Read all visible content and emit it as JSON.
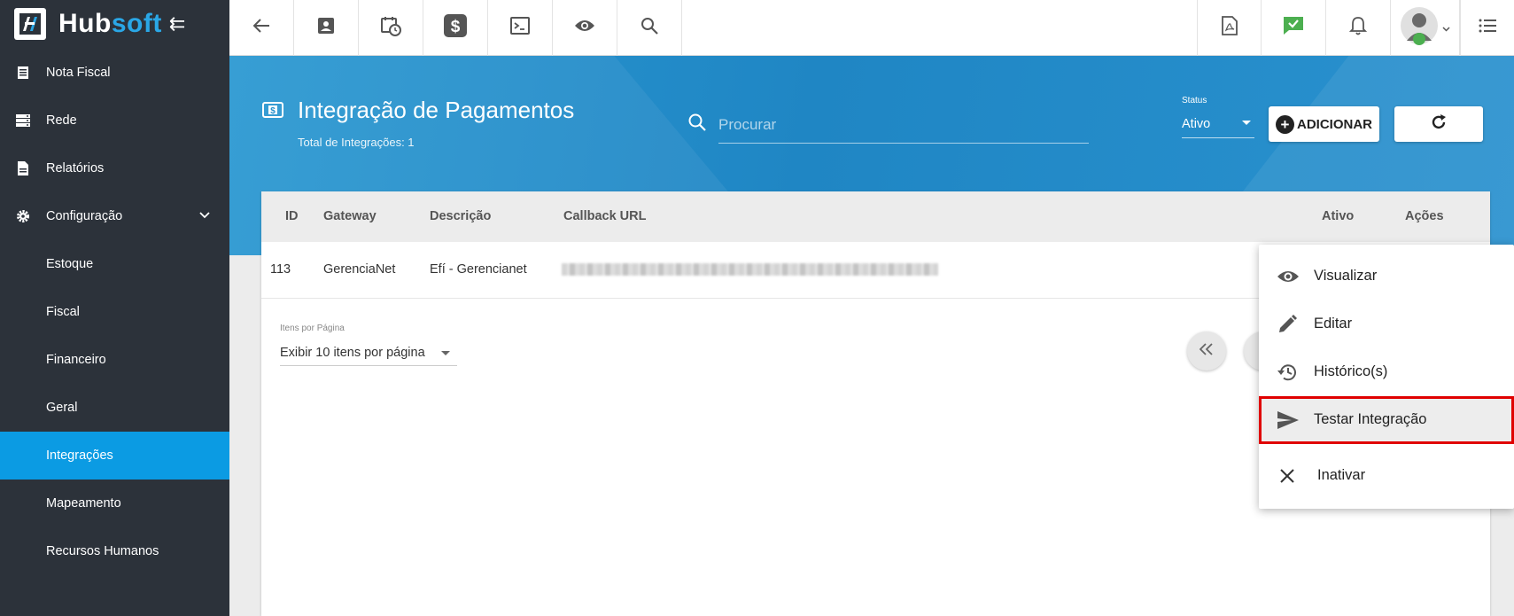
{
  "brand": {
    "name_part1": "Hub",
    "name_part2": "soft"
  },
  "sidebar": {
    "items": [
      {
        "label": "Nota Fiscal",
        "icon": "document-icon"
      },
      {
        "label": "Rede",
        "icon": "server-icon"
      },
      {
        "label": "Relatórios",
        "icon": "report-icon"
      },
      {
        "label": "Configuração",
        "icon": "gear-icon",
        "expanded": true
      },
      {
        "label": "Estoque"
      },
      {
        "label": "Fiscal"
      },
      {
        "label": "Financeiro"
      },
      {
        "label": "Geral"
      },
      {
        "label": "Integrações",
        "active": true
      },
      {
        "label": "Mapeamento"
      },
      {
        "label": "Recursos Humanos"
      }
    ]
  },
  "topbar": {
    "icons": [
      "back-arrow-icon",
      "contact-card-icon",
      "calendar-clock-icon",
      "dollar-icon",
      "terminal-icon",
      "eye-icon",
      "search-icon",
      "pdf-icon",
      "chat-check-icon",
      "bell-icon",
      "user-avatar",
      "list-menu-icon"
    ]
  },
  "page": {
    "title": "Integração de Pagamentos",
    "subtitle": "Total de Integrações: 1",
    "search_placeholder": "Procurar",
    "status_label": "Status",
    "status_value": "Ativo",
    "add_button": "ADICIONAR"
  },
  "table": {
    "headers": [
      "ID",
      "Gateway",
      "Descrição",
      "Callback URL",
      "Ativo",
      "Ações"
    ],
    "rows": [
      {
        "id": "113",
        "gateway": "GerenciaNet",
        "descricao": "Efí - Gerencianet",
        "callback_url": "(blurred)"
      }
    ]
  },
  "pagination": {
    "label": "Itens por Página",
    "value": "Exibir 10 itens por página"
  },
  "menu": {
    "items": [
      {
        "label": "Visualizar",
        "icon": "eye-icon"
      },
      {
        "label": "Editar",
        "icon": "pencil-icon"
      },
      {
        "label": "Histórico(s)",
        "icon": "history-icon"
      },
      {
        "label": "Testar Integração",
        "icon": "send-icon",
        "highlighted": true
      },
      {
        "label": "Inativar",
        "icon": "close-icon"
      }
    ]
  },
  "colors": {
    "sidebar_bg": "#2c323a",
    "active": "#0b9be3",
    "hero": "#2590cc",
    "highlight_border": "#e00000",
    "chat_green": "#4caf50"
  }
}
